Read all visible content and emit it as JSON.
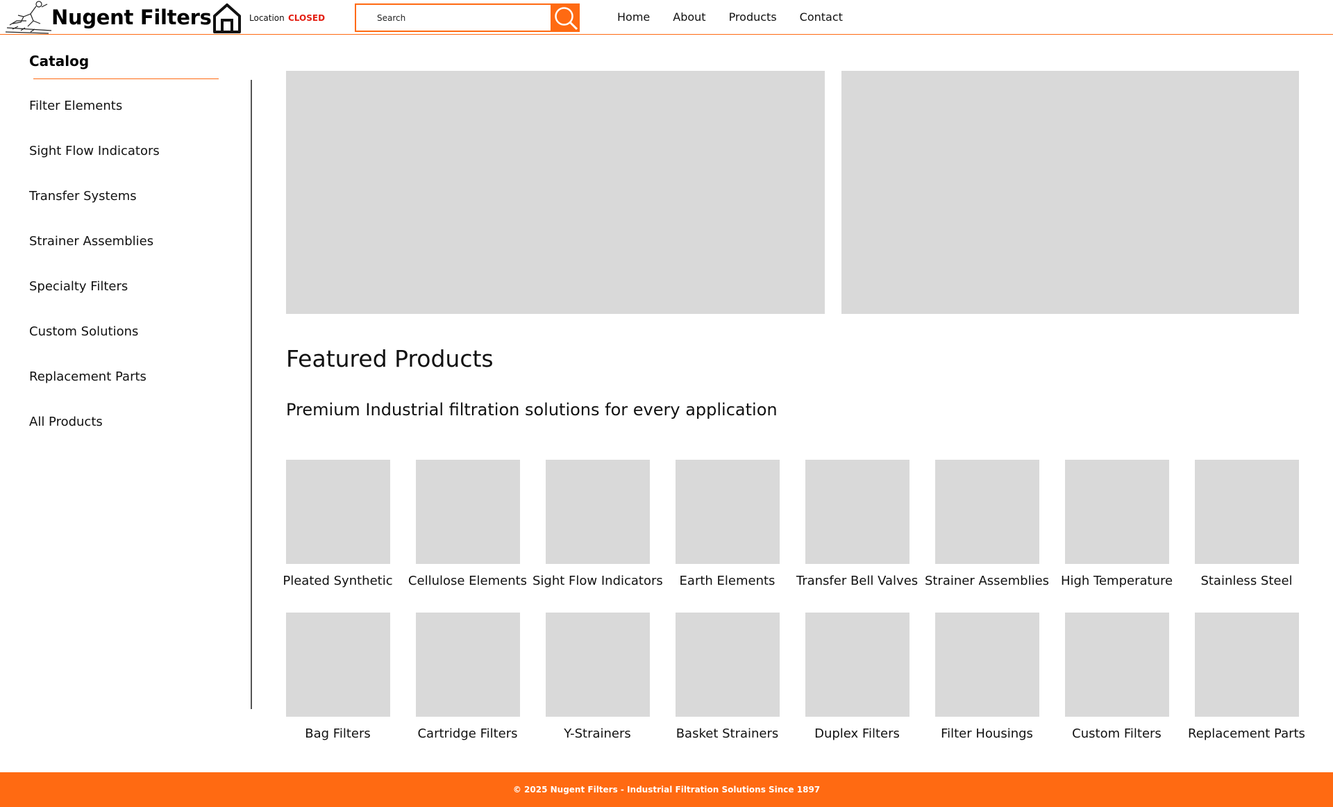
{
  "header": {
    "brand": "Nugent Filters",
    "location_label": "Location",
    "location_status": "CLOSED",
    "search_placeholder": "Search",
    "nav": [
      "Home",
      "About",
      "Products",
      "Contact"
    ]
  },
  "sidebar": {
    "title": "Catalog",
    "items": [
      "Filter Elements",
      "Sight Flow Indicators",
      "Transfer Systems",
      "Strainer Assemblies",
      "Specialty Filters",
      "Custom Solutions",
      "Replacement Parts",
      "All Products"
    ]
  },
  "main": {
    "title": "Featured Products",
    "subtitle": "Premium Industrial filtration solutions for every application",
    "products_row1": [
      "Pleated Synthetic",
      "Cellulose Elements",
      "Sight Flow Indicators",
      "Earth Elements",
      "Transfer Bell Valves",
      "Strainer Assemblies",
      "High Temperature",
      "Stainless Steel"
    ],
    "products_row2": [
      "Bag Filters",
      "Cartridge Filters",
      "Y-Strainers",
      "Basket Strainers",
      "Duplex Filters",
      "Filter Housings",
      "Custom Filters",
      "Replacement Parts"
    ]
  },
  "footer": {
    "text": "© 2025 Nugent Filters - Industrial Filtration Solutions Since 1897"
  },
  "colors": {
    "accent": "#ff6a12",
    "status_closed": "#e31e12",
    "placeholder_gray": "#d9d9d9"
  },
  "icons": [
    "logo-sketch-icon",
    "home-icon",
    "search-icon"
  ]
}
